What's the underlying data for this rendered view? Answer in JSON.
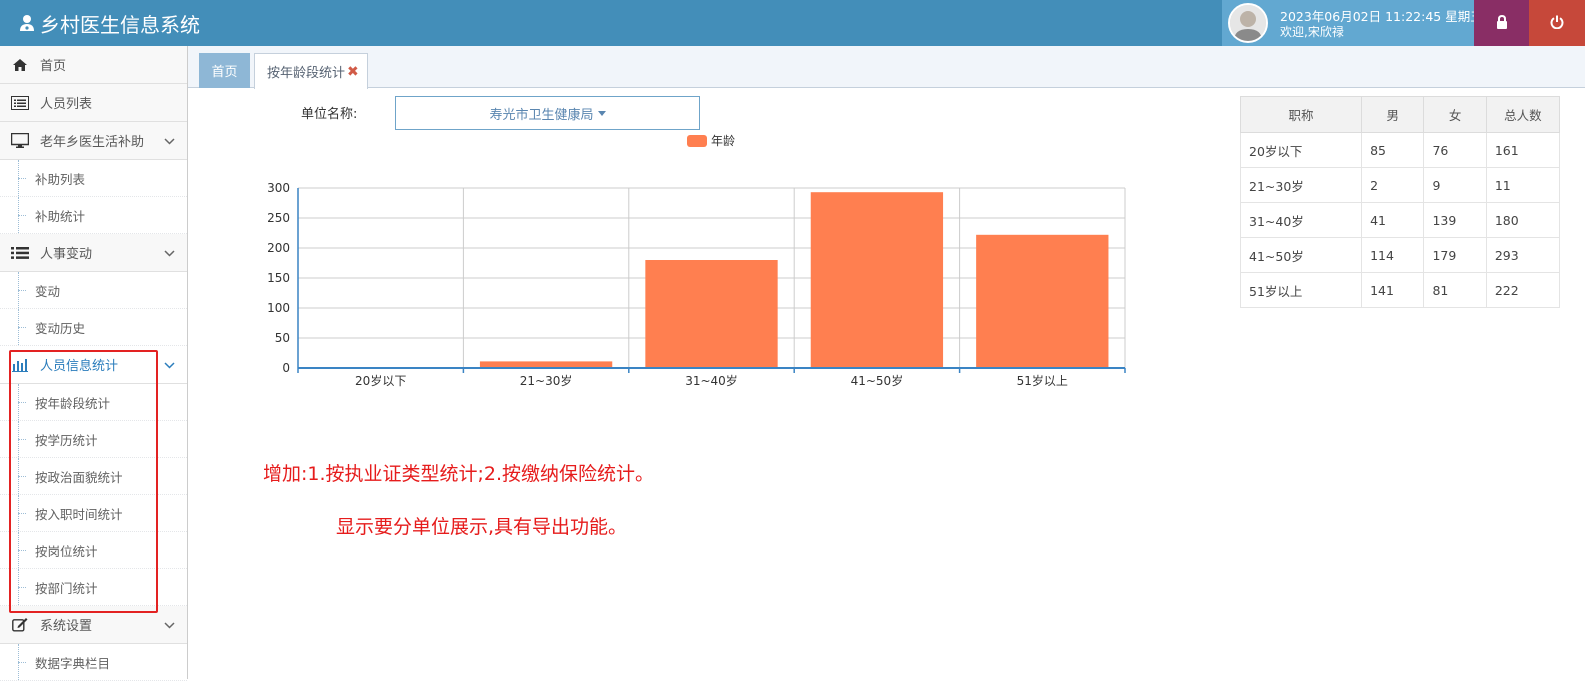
{
  "app": {
    "title": "乡村医生信息系统",
    "datetime": "2023年06月02日 11:22:45 星期五",
    "welcome": "欢迎,宋欣禄"
  },
  "sidebar": {
    "sections": [
      {
        "label": "首页",
        "icon": "home-icon"
      },
      {
        "label": "人员列表",
        "icon": "list-icon"
      },
      {
        "label": "老年乡医生活补助",
        "icon": "desktop-icon",
        "children": [
          "补助列表",
          "补助统计"
        ]
      },
      {
        "label": "人事变动",
        "icon": "list-bullets-icon",
        "children": [
          "变动",
          "变动历史"
        ]
      },
      {
        "label": "人员信息统计",
        "icon": "bar-chart-icon",
        "active": true,
        "children": [
          "按年龄段统计",
          "按学历统计",
          "按政治面貌统计",
          "按入职时间统计",
          "按岗位统计",
          "按部门统计"
        ]
      },
      {
        "label": "系统设置",
        "icon": "edit-icon",
        "children": [
          "数据字典栏目"
        ]
      }
    ]
  },
  "tabs": [
    {
      "label": "首页"
    },
    {
      "label": "按年龄段统计"
    }
  ],
  "filter": {
    "label": "单位名称:",
    "value": "寿光市卫生健康局"
  },
  "chart_data": {
    "type": "bar",
    "categories": [
      "20岁以下",
      "21~30岁",
      "31~40岁",
      "41~50岁",
      "51岁以上"
    ],
    "series": [
      {
        "name": "年龄",
        "values": [
          0,
          11,
          180,
          293,
          222
        ]
      }
    ],
    "yticks": [
      0,
      50,
      100,
      150,
      200,
      250,
      300
    ],
    "ylim": [
      0,
      300
    ],
    "legend": "top-center",
    "grid": true,
    "color": "#ff7f50"
  },
  "stats_table": {
    "headers": [
      "职称",
      "男",
      "女",
      "总人数"
    ],
    "rows": [
      [
        "20岁以下",
        "85",
        "76",
        "161"
      ],
      [
        "21~30岁",
        "2",
        "9",
        "11"
      ],
      [
        "31~40岁",
        "41",
        "139",
        "180"
      ],
      [
        "41~50岁",
        "114",
        "179",
        "293"
      ],
      [
        "51岁以上",
        "141",
        "81",
        "222"
      ]
    ]
  },
  "notes": {
    "line1": "增加:1.按执业证类型统计;2.按缴纳保险统计。",
    "line2": "显示要分单位展示,具有导出功能。"
  },
  "colors": {
    "header": "#438eb9",
    "accent": "#2b7dbc",
    "bar": "#ff7f50",
    "annotation": "#e61c1c"
  }
}
